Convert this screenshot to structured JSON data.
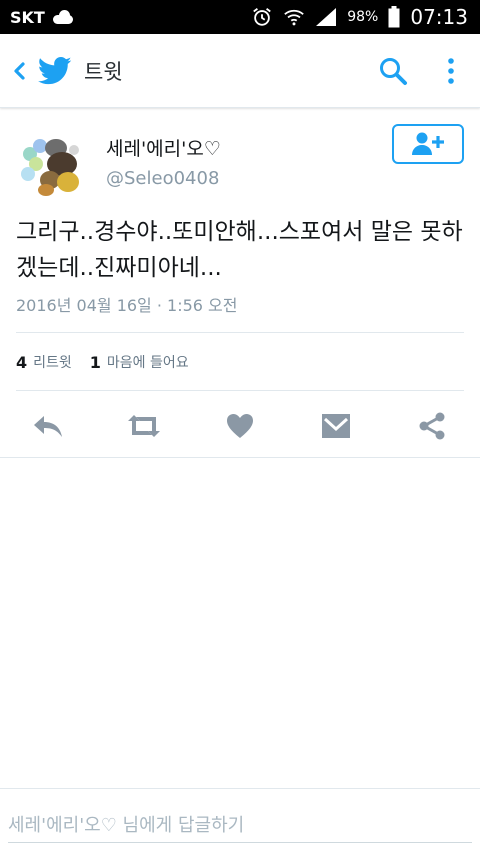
{
  "status_bar": {
    "carrier": "SKT",
    "battery": "98%",
    "time": "07:13",
    "icons": [
      "cloud-icon",
      "alarm-icon",
      "wifi-icon",
      "signal-icon",
      "battery-icon"
    ]
  },
  "app_bar": {
    "title": "트윗",
    "icons": [
      "back-icon",
      "twitter-bird-icon",
      "search-icon",
      "more-vert-icon"
    ]
  },
  "tweet": {
    "display_name": "세레'에리'오♡",
    "handle": "@Seleo0408",
    "text": "그리구..경수야..또미안해...스포여서 말은 못하겠는데..진짜미아네...",
    "timestamp": "2016년 04월 16일 · 1:56 오전",
    "retweet_count": "4",
    "retweet_label": "리트윗",
    "like_count": "1",
    "like_label": "마음에 들어요",
    "action_icons": [
      "reply-icon",
      "retweet-icon",
      "heart-icon",
      "direct-message-icon",
      "share-icon"
    ]
  },
  "reply": {
    "placeholder": "세레'에리'오♡ 님에게 답글하기"
  },
  "colors": {
    "accent": "#1da1f2",
    "action_gray": "#8b98a5",
    "muted_text": "#8899a6"
  }
}
